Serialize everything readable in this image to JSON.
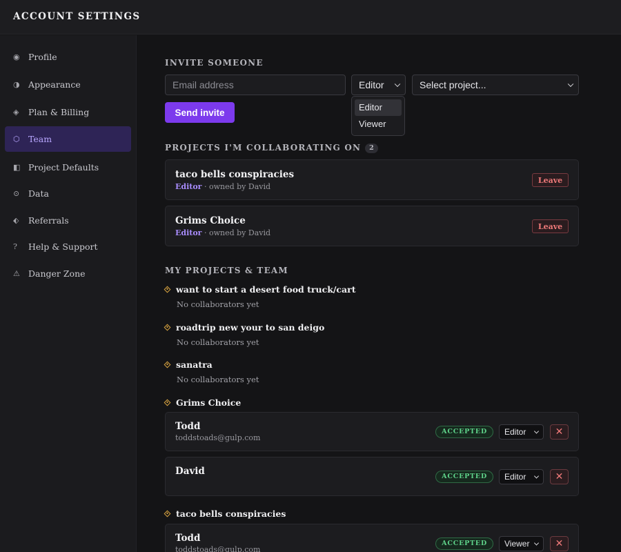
{
  "app": {
    "title": "ACCOUNT SETTINGS"
  },
  "sidebar": {
    "items": [
      {
        "label": "Profile",
        "icon": "◉"
      },
      {
        "label": "Appearance",
        "icon": "◑"
      },
      {
        "label": "Plan & Billing",
        "icon": "◈"
      },
      {
        "label": "Team",
        "icon": "⬡",
        "active": true
      },
      {
        "label": "Project Defaults",
        "icon": "◧"
      },
      {
        "label": "Data",
        "icon": "⊙"
      },
      {
        "label": "Referrals",
        "icon": "⬖"
      },
      {
        "label": "Help & Support",
        "icon": "?"
      },
      {
        "label": "Danger Zone",
        "icon": "⚠"
      }
    ]
  },
  "invite": {
    "title": "INVITE SOMEONE",
    "email_placeholder": "Email address",
    "role_value": "Editor",
    "project_placeholder": "Select project...",
    "send_label": "Send invite",
    "role_options": [
      "Editor",
      "Viewer"
    ]
  },
  "collaborating": {
    "title": "PROJECTS I'M COLLABORATING ON",
    "count": "2",
    "projects": [
      {
        "name": "taco bells conspiracies",
        "role": "Editor",
        "owner": "· owned by David",
        "action": "Leave"
      },
      {
        "name": "Grims Choice",
        "role": "Editor",
        "owner": "· owned by David",
        "action": "Leave"
      }
    ]
  },
  "my_projects": {
    "title": "MY PROJECTS & TEAM",
    "empty_note": "No collaborators yet",
    "projects": [
      {
        "name": "want to start a desert food truck/cart"
      },
      {
        "name": "roadtrip new your to san deigo"
      },
      {
        "name": "sanatra"
      },
      {
        "name": "Grims Choice",
        "members": [
          {
            "name": "Todd",
            "email": "toddstoads@gulp.com",
            "status": "ACCEPTED",
            "role": "Editor"
          },
          {
            "name": "David",
            "email": "",
            "status": "ACCEPTED",
            "role": "Editor"
          }
        ]
      },
      {
        "name": "taco bells conspiracies",
        "members": [
          {
            "name": "Todd",
            "email": "toddstoads@gulp.com",
            "status": "ACCEPTED",
            "role": "Viewer"
          }
        ]
      }
    ]
  },
  "icons": {
    "diamond": "diamond-icon",
    "close": "close-icon",
    "chevron": "chevron-down-icon"
  },
  "colors": {
    "accent": "#7c3aed",
    "accent_text": "#a78bfa",
    "danger": "#f07a7a",
    "success": "#5fd38a",
    "project_marker": "#d9a441"
  }
}
